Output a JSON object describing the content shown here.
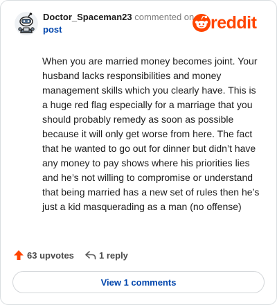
{
  "comment": {
    "username": "Doctor_Spaceman23",
    "action_text": "commented on",
    "post_link_text": "post",
    "body": "When you are married money becomes joint. Your husband lacks responsibilities and money management skills which you clearly have. This is a huge red flag especially for a marriage that you should probably remedy as soon as possible because it will only get worse from here. The fact that he wanted to go out for dinner but didn’t have any money to pay shows where his priorities lies and he’s not willing to compromise or understand that being married has a new set of rules then he’s just a kid masquerading as a man (no offense)"
  },
  "brand": {
    "logo_text": "reddit",
    "logo_icon": "reddit-alien-icon",
    "color": "#ff4500"
  },
  "actions": {
    "upvotes_label": "63 upvotes",
    "upvote_icon": "upvote-arrow-icon",
    "upvote_color": "#ff4500",
    "replies_label": "1 reply",
    "reply_icon": "reply-arrow-icon"
  },
  "view_comments_button": "View 1 comments",
  "colors": {
    "link": "#0045ac",
    "border": "#d9dde0",
    "muted_text": "#7c7c7c"
  }
}
